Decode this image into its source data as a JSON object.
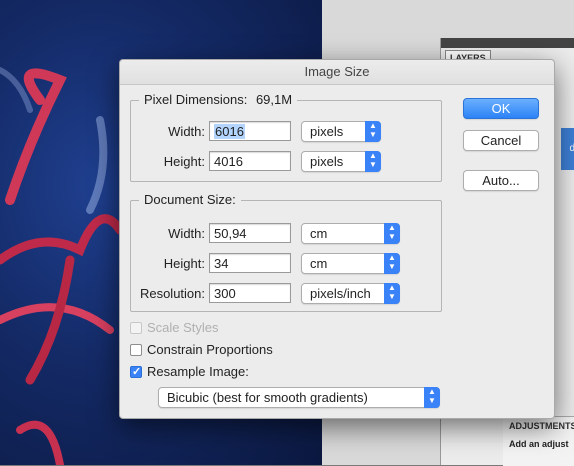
{
  "dialog": {
    "title": "Image Size",
    "pixel_dimensions": {
      "label": "Pixel Dimensions:",
      "size": "69,1M",
      "width_label": "Width:",
      "width_value": "6016",
      "width_unit": "pixels",
      "height_label": "Height:",
      "height_value": "4016",
      "height_unit": "pixels"
    },
    "document_size": {
      "label": "Document Size:",
      "width_label": "Width:",
      "width_value": "50,94",
      "width_unit": "cm",
      "height_label": "Height:",
      "height_value": "34",
      "height_unit": "cm",
      "resolution_label": "Resolution:",
      "resolution_value": "300",
      "resolution_unit": "pixels/inch"
    },
    "buttons": {
      "ok": "OK",
      "cancel": "Cancel",
      "auto": "Auto..."
    },
    "checkboxes": {
      "scale_styles": {
        "label": "Scale Styles",
        "checked": false,
        "enabled": false
      },
      "constrain": {
        "label": "Constrain Proportions",
        "checked": false
      },
      "resample": {
        "label": "Resample Image:",
        "checked": true
      }
    },
    "resample_method": "Bicubic (best for smooth gradients)"
  },
  "background_panel": {
    "layers_tab": "LAYERS",
    "side_letter": "d",
    "adjustments_title": "ADJUSTMENTS",
    "adjustments_hint": "Add an adjust"
  },
  "colors": {
    "accent": "#3a82f7",
    "photo_bg": "#142a66",
    "coral": "#c8304a"
  }
}
